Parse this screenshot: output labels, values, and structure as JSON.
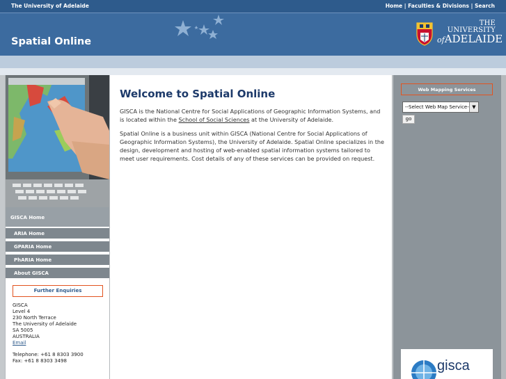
{
  "topbar": {
    "university_link": "The University of Adelaide",
    "home": "Home",
    "sep1": "|",
    "faculties": "Faculties & Divisions",
    "sep2": "|",
    "search": "Search"
  },
  "header": {
    "site_title": "Spatial Online",
    "logo_line1": "THE UNIVERSITY",
    "logo_of": "of",
    "logo_line2": "ADELAIDE"
  },
  "sidebar": {
    "gisca_home": "GISCA Home",
    "items": [
      {
        "label": "ARIA Home"
      },
      {
        "label": "GPARIA Home"
      },
      {
        "label": "PhARIA Home"
      },
      {
        "label": "About GISCA"
      }
    ],
    "enquiries_title": "Further Enquiries",
    "address": [
      "GISCA",
      "Level 4",
      "230 North Terrace",
      "The University of Adelaide",
      "SA 5005",
      "AUSTRALIA"
    ],
    "email": "Email",
    "telephone": "Telephone: +61 8 8303 3900",
    "fax": "Fax: +61 8 8303 3498"
  },
  "main": {
    "heading": "Welcome to Spatial Online",
    "p1_before": "GISCA is the National Centre for Social Applications of Geographic Information Systems, and is located within the ",
    "p1_link": "School of Social Sciences",
    "p1_after": " at the University of Adelaide.",
    "p2": "Spatial Online is a business unit within GISCA (National Centre for Social Applications of Geographic Information Systems), the University of Adelaide. Spatial Online specializes in the design, development and hosting of web-enabled spatial information systems tailored to meet user requirements. Cost details of any of these services can be provided on request."
  },
  "right": {
    "wms_title": "Web Mapping Services",
    "select_value": "--Select Web Map Service--",
    "go_label": "go",
    "gisca_logo_text": "gisca"
  },
  "colors": {
    "header_blue": "#3c6b9f",
    "topbar_blue": "#2e5b8c",
    "accent_orange": "#e2531f",
    "heading_navy": "#1d3a6a"
  }
}
